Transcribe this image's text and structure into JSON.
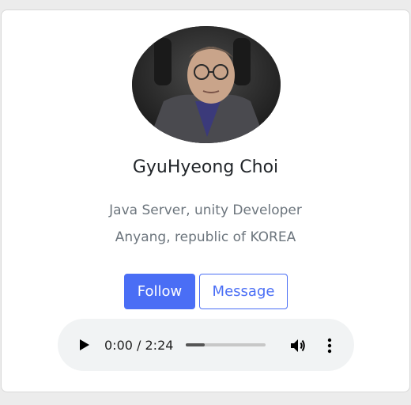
{
  "profile": {
    "name": "GyuHyeong Choi",
    "role": "Java Server, unity Developer",
    "location": "Anyang, republic of KOREA"
  },
  "actions": {
    "follow_label": "Follow",
    "message_label": "Message"
  },
  "audio": {
    "time_display": "0:00 / 2:24",
    "progress_fraction": 0.24
  },
  "colors": {
    "accent": "#4a6ef5",
    "page_background": "#ececec"
  },
  "icons": {
    "play": "play-icon",
    "volume": "volume-icon",
    "more": "more-options-icon"
  }
}
